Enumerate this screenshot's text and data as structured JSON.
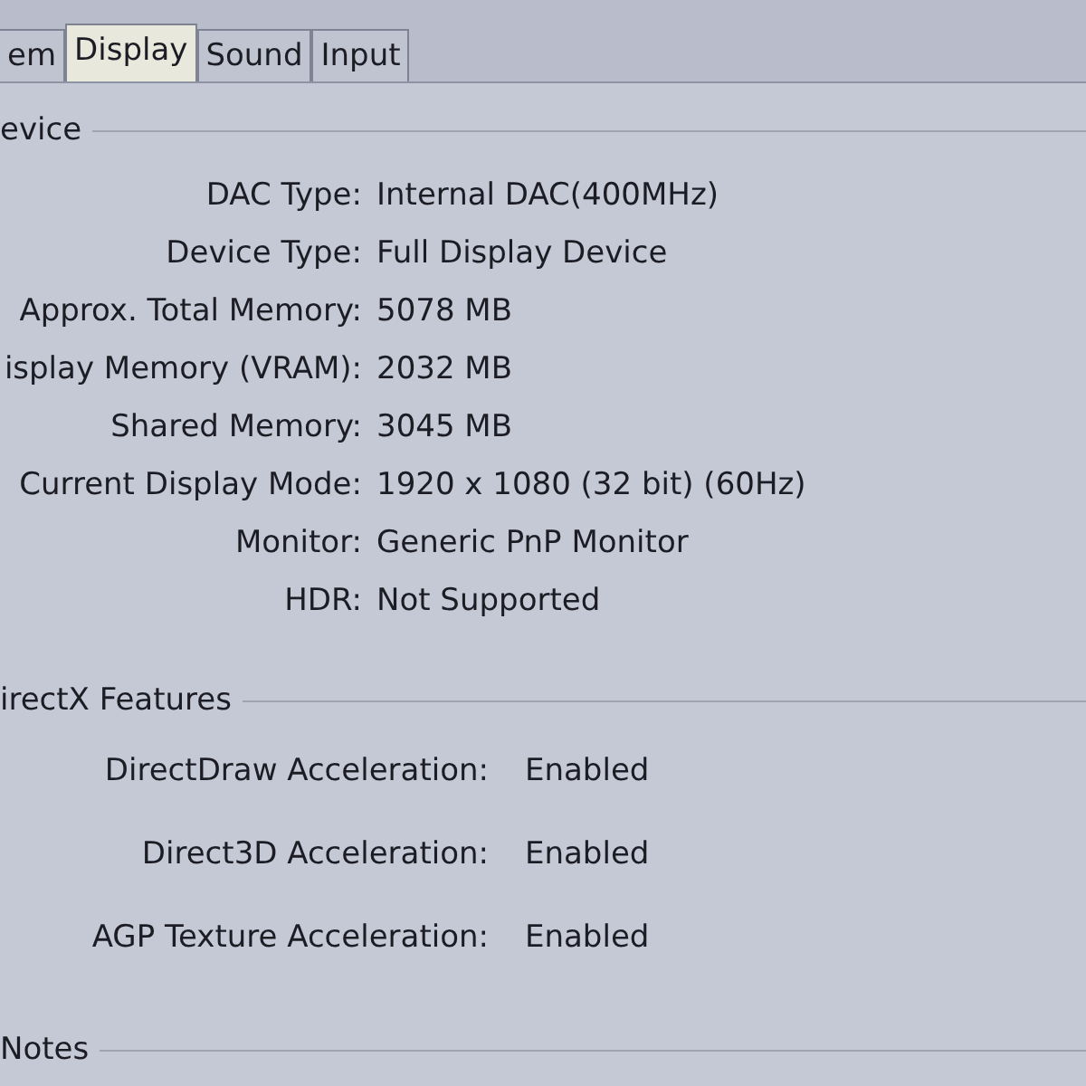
{
  "tabs": [
    {
      "label": "em",
      "selected": false
    },
    {
      "label": "Display",
      "selected": true
    },
    {
      "label": "Sound",
      "selected": false
    },
    {
      "label": "Input",
      "selected": false
    }
  ],
  "device": {
    "title": "evice",
    "rows": [
      {
        "label": "DAC Type:",
        "value": "Internal DAC(400MHz)"
      },
      {
        "label": "Device Type:",
        "value": "Full Display Device"
      },
      {
        "label": "Approx. Total Memory:",
        "value": "5078 MB"
      },
      {
        "label": "isplay Memory (VRAM):",
        "value": "2032 MB"
      },
      {
        "label": "Shared Memory:",
        "value": "3045 MB"
      },
      {
        "label": "Current Display Mode:",
        "value": "1920 x 1080 (32 bit) (60Hz)"
      },
      {
        "label": "Monitor:",
        "value": "Generic PnP Monitor"
      },
      {
        "label": "HDR:",
        "value": "Not Supported"
      }
    ]
  },
  "directx_features": {
    "title": "irectX Features",
    "rows": [
      {
        "label": "DirectDraw Acceleration:",
        "value": "Enabled"
      },
      {
        "label": "Direct3D Acceleration:",
        "value": "Enabled"
      },
      {
        "label": "AGP Texture Acceleration:",
        "value": "Enabled"
      }
    ]
  },
  "notes": {
    "title": "Notes"
  }
}
